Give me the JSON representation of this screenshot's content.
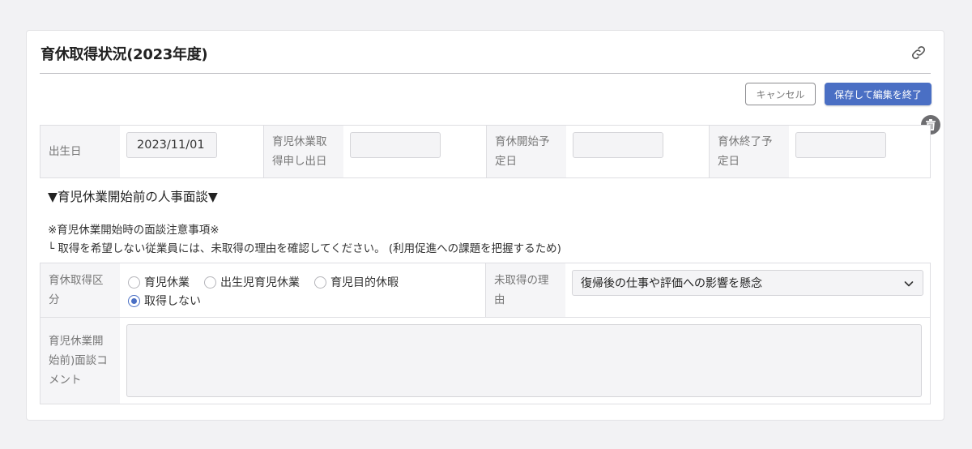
{
  "panel": {
    "title": "育休取得状況(2023年度)",
    "cancel_label": "キャンセル",
    "save_label": "保存して編集を終了"
  },
  "dates": {
    "birth_label": "出生日",
    "birth_value": "2023/11/01",
    "request_label": "育児休業取得申し出日",
    "request_value": "",
    "start_label": "育休開始予定日",
    "start_value": "",
    "end_label": "育休終了予定日",
    "end_value": ""
  },
  "interview": {
    "heading": "▼育児休業開始前の人事面談▼",
    "note_title": "※育児休業開始時の面談注意事項※",
    "note_body": "└ 取得を希望しない従業員には、未取得の理由を確認してください。 (利用促進への課題を把握するため)"
  },
  "leave_type": {
    "label": "育休取得区分",
    "options": [
      "育児休業",
      "出生児育児休業",
      "育児目的休暇",
      "取得しない"
    ],
    "selected": "取得しない"
  },
  "reason": {
    "label": "未取得の理由",
    "selected_value": "復帰後の仕事や評価への影響を懸念"
  },
  "comment": {
    "label": "育児休業開始前)面談コメント",
    "value": ""
  },
  "colors": {
    "accent": "#4a6fc4",
    "label_bg": "#f5f5f7",
    "border": "#dedee2"
  }
}
